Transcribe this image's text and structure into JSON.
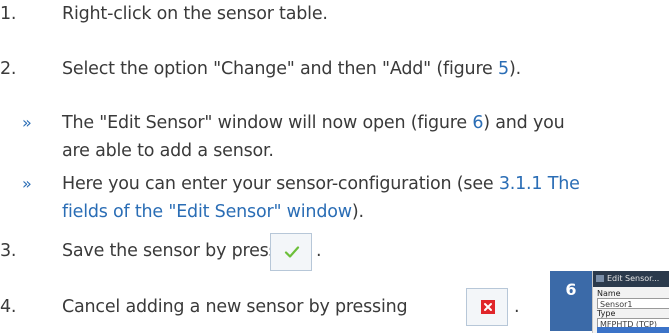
{
  "steps": [
    {
      "number": "1.",
      "text": "Right-click on the sensor table."
    },
    {
      "number": "2.",
      "text": "Select the option \"Change\" and then \"Add\" (figure ",
      "fig": "5",
      "suffix": ")."
    },
    {
      "number": "3.",
      "text": "Save the sensor by pressing",
      "after": "."
    },
    {
      "number": "4.",
      "text": "Cancel adding a new sensor by pressing",
      "after": "."
    }
  ],
  "notes": [
    {
      "bullet": "»",
      "line1_a": "The \"Edit Sensor\" window will now open (figure ",
      "line1_fig": "6",
      "line1_b": ") and you",
      "line2": "are able to add a sensor."
    },
    {
      "bullet": "»",
      "line1_a": "Here you can enter your sensor-configuration (see ",
      "line1_link": "3.1.1 The",
      "line2_link": "fields of the \"Edit Sensor\" window",
      "line2_b": ")."
    }
  ],
  "figure": {
    "number": "6",
    "window_title": "Edit Sensor...",
    "name_label": "Name",
    "name_value": "Sensor1",
    "type_label": "Type",
    "type_value": "MFPHTD (TCP)"
  },
  "buttons": {
    "save_icon": "checkmark-icon",
    "cancel_icon": "close-x-icon"
  },
  "colors": {
    "link": "#2a6db5",
    "badge": "#3b6aa8",
    "text": "#3a3a3a"
  }
}
